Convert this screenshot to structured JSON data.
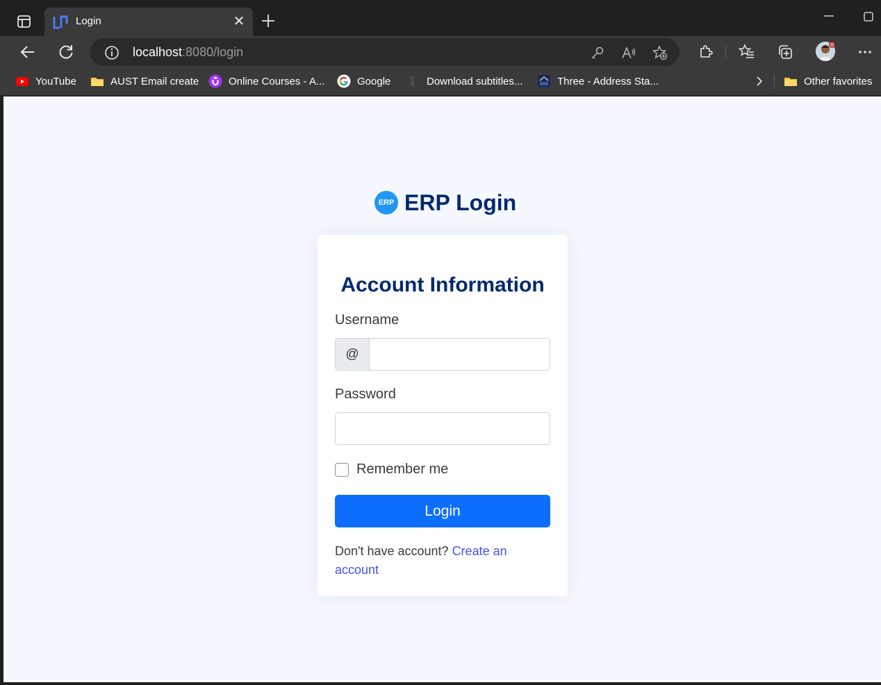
{
  "browser": {
    "tab": {
      "title": "Login",
      "close_glyph": "✕"
    },
    "address": {
      "host": "localhost",
      "rest": ":8080/login"
    },
    "favorites": [
      {
        "label": "YouTube",
        "icon": "youtube-icon"
      },
      {
        "label": "AUST Email create",
        "icon": "folder-icon"
      },
      {
        "label": "Online Courses - A...",
        "icon": "udemy-icon"
      },
      {
        "label": "Google",
        "icon": "google-icon"
      },
      {
        "label": "Download subtitles...",
        "icon": "generic-page-icon"
      },
      {
        "label": "Three - Address Sta...",
        "icon": "site-icon"
      }
    ],
    "other_favorites": "Other favorites"
  },
  "page": {
    "brand": {
      "logo_text": "ERP",
      "title": "ERP Login"
    },
    "card": {
      "title": "Account Information",
      "username_label": "Username",
      "username_prefix": "@",
      "username_value": "",
      "password_label": "Password",
      "password_value": "",
      "remember_label": "Remember me",
      "remember_checked": false,
      "login_button": "Login",
      "signup_text": "Don't have account?",
      "signup_link": "Create an account"
    }
  },
  "colors": {
    "primary": "#0d6efd",
    "heading": "#012970",
    "link": "#4154f1",
    "page_bg": "#f5f8fe",
    "chrome_dark": "#202020",
    "chrome_mid": "#3a3a3a"
  }
}
